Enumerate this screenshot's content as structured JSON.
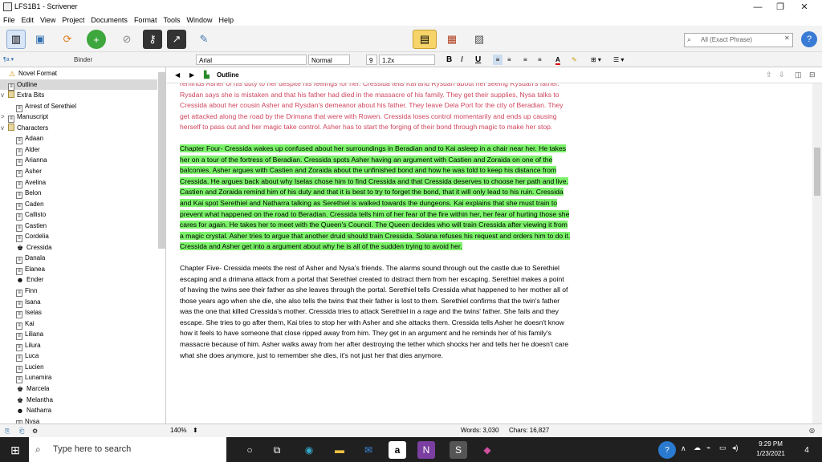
{
  "window": {
    "title": "LFS1B1 - Scrivener",
    "minimize": "—",
    "maximize": "❐",
    "close": "✕"
  },
  "menu": [
    "File",
    "Edit",
    "View",
    "Project",
    "Documents",
    "Format",
    "Tools",
    "Window",
    "Help"
  ],
  "toolbar": {
    "search_placeholder": "All (Exact Phrase)"
  },
  "formatbar": {
    "font": "Arial",
    "style": "Normal",
    "size": "9",
    "line_spacing": "1.2x",
    "bold": "B",
    "italic": "I",
    "underline": "U"
  },
  "binder": {
    "header": "Binder",
    "items": [
      {
        "label": "Novel Format",
        "icon": "warning",
        "indent": 0
      },
      {
        "label": "Outline",
        "icon": "doc",
        "indent": 0,
        "selected": true
      },
      {
        "label": "Extra Bits",
        "icon": "folder",
        "indent": 0,
        "toggle": "v"
      },
      {
        "label": "Arrest of Serethiel",
        "icon": "doc",
        "indent": 1
      },
      {
        "label": "Manuscript",
        "icon": "doc",
        "indent": 0,
        "toggle": ">"
      },
      {
        "label": "Characters",
        "icon": "folder",
        "indent": 0,
        "toggle": "v"
      },
      {
        "label": "Adaan",
        "icon": "doc",
        "indent": 1
      },
      {
        "label": "Alder",
        "icon": "doc",
        "indent": 1
      },
      {
        "label": "Arianna",
        "icon": "doc",
        "indent": 1
      },
      {
        "label": "Asher",
        "icon": "doc",
        "indent": 1
      },
      {
        "label": "Avelina",
        "icon": "doc",
        "indent": 1
      },
      {
        "label": "Belon",
        "icon": "doc",
        "indent": 1
      },
      {
        "label": "Caden",
        "icon": "doc",
        "indent": 1
      },
      {
        "label": "Callisto",
        "icon": "doc",
        "indent": 1
      },
      {
        "label": "Castien",
        "icon": "doc",
        "indent": 1
      },
      {
        "label": "Cordelia",
        "icon": "doc",
        "indent": 1
      },
      {
        "label": "Cressida",
        "icon": "crown",
        "indent": 1
      },
      {
        "label": "Danala",
        "icon": "doc",
        "indent": 1
      },
      {
        "label": "Elanea",
        "icon": "doc",
        "indent": 1
      },
      {
        "label": "Ender",
        "icon": "devil",
        "indent": 1
      },
      {
        "label": "Finn",
        "icon": "doc",
        "indent": 1
      },
      {
        "label": "Isana",
        "icon": "doc",
        "indent": 1
      },
      {
        "label": "Iselas",
        "icon": "doc",
        "indent": 1
      },
      {
        "label": "Kai",
        "icon": "doc",
        "indent": 1
      },
      {
        "label": "Liliana",
        "icon": "doc",
        "indent": 1
      },
      {
        "label": "Lilura",
        "icon": "doc",
        "indent": 1
      },
      {
        "label": "Luca",
        "icon": "doc",
        "indent": 1
      },
      {
        "label": "Lucien",
        "icon": "doc",
        "indent": 1
      },
      {
        "label": "Lunamira",
        "icon": "doc",
        "indent": 1
      },
      {
        "label": "Marcela",
        "icon": "crown",
        "indent": 1
      },
      {
        "label": "Melantha",
        "icon": "crown",
        "indent": 1
      },
      {
        "label": "Natharra",
        "icon": "devil",
        "indent": 1
      },
      {
        "label": "Nysa",
        "icon": "doc",
        "indent": 1
      }
    ]
  },
  "editor": {
    "doc_title": "Outline",
    "para_partial": "reminds Asher of his duty to her despite his feelings for her. Cressida tells Kai and Rysdan about her seeing Rysdan's father. Rysdan says she is mistaken and that his father had died in the massacre of his family. They get their supplies, Nysa talks to Cressida about her cousin Asher and Rysdan's demeanor about his father. They leave Dela Port for the city of Beradian. They get attacked along the road by the Drimana that were with Rowen. Cressida loses control momentarily and ends up causing herself to pass out and her magic take control. Asher has to start the forging of their bond through magic to make her stop.",
    "para_ch4": "Chapter Four- Cressida wakes up confused about her surroundings in Beradian and to Kai asleep in a chair near her. He takes her on a tour of the fortress of Beradian. Cressida spots Asher having an argument with Castien and Zoraida on one of the balconies.  Asher argues with Castien and Zoraida about the unfinished bond and how he was told to keep his distance from Cressida. He argues back about why Iselas chose him to find Cressida and that Cressida deserves to choose her path and live.  Castien and Zoraida remind him of his duty and that it is best to try to forget the bond, that it will only lead to his ruin. Cressida and Kai spot Serethiel and Natharra talking as Serethiel is walked towards the dungeons. Kai explains that she must train to prevent what happened on the road to Beradian. Cressida tells him of her fear of the fire within her, her fear of hurting those she cares for again. He takes her to meet with the Queen's Council. The Queen decides who will train Cressida after viewing it from a magic crystal. Asher tries to argue that another druid should train Cressida. Solana refuses his request and orders him to do it. Cressida and Asher get into a argument about why he is all of the sudden trying to avoid her.",
    "para_ch5": "Chapter Five- Cressida meets the rest of Asher and Nysa's friends. The alarms sound through out the castle due to Serethiel escaping and a drimana attack from a portal that Serethiel created to distract them from her escaping.  Serethiel makes a point of having the twins see their father as she leaves through the portal. Serethiel tells Cressida  what happened to her mother all of those years ago when she die, she also tells the twins that their father is lost to them. Serethiel confirms that the twin's father was the one that killed Cressida's mother. Cressida tries to attack Serethiel in a rage and the twins' father. She fails and they escape. She tries to go after them, Kai tries to stop her with Asher and she attacks them. Cressida tells Asher he doesn't know how it feels to have someone that close ripped away from him. They get in an argument and he reminds her of his family's massacre because of him. Asher walks away from her after destroying the tether which shocks her and tells her he doesn't care what she does anymore, just to remember she dies, it's not just her that dies anymore."
  },
  "footer": {
    "zoom": "140%",
    "words": "Words: 3,030",
    "chars": "Chars: 16,827"
  },
  "taskbar": {
    "search_placeholder": "Type here to search",
    "time": "9:29 PM",
    "date": "1/23/2021",
    "notifications": "4"
  }
}
